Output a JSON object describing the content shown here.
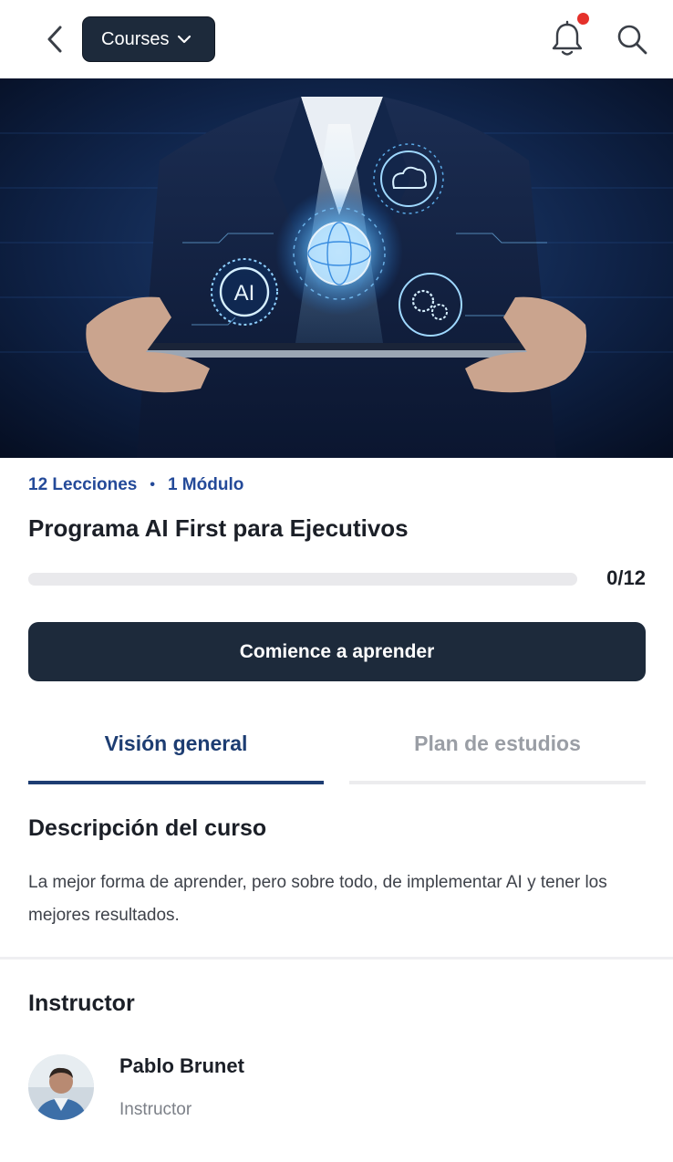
{
  "header": {
    "courses_label": "Courses",
    "has_notification": true,
    "notification_color": "#e5312b"
  },
  "hero": {
    "ai_label": "AI"
  },
  "course": {
    "lessons": "12 Lecciones",
    "separator": "•",
    "modules": "1 Módulo",
    "title": "Programa AI First para Ejecutivos",
    "progress_count": "0/12",
    "progress_fraction": 0,
    "cta_label": "Comience a aprender"
  },
  "tabs": [
    {
      "label": "Visión general",
      "active": true
    },
    {
      "label": "Plan de estudios",
      "active": false
    }
  ],
  "description": {
    "heading": "Descripción del curso",
    "text": "La mejor forma de aprender, pero sobre todo, de implementar AI y tener los mejores resultados."
  },
  "instructor": {
    "heading": "Instructor",
    "name": "Pablo Brunet",
    "role": "Instructor"
  },
  "colors": {
    "primary": "#1d2a3b",
    "accent_text": "#244a99",
    "tab_active": "#1d3d72"
  }
}
